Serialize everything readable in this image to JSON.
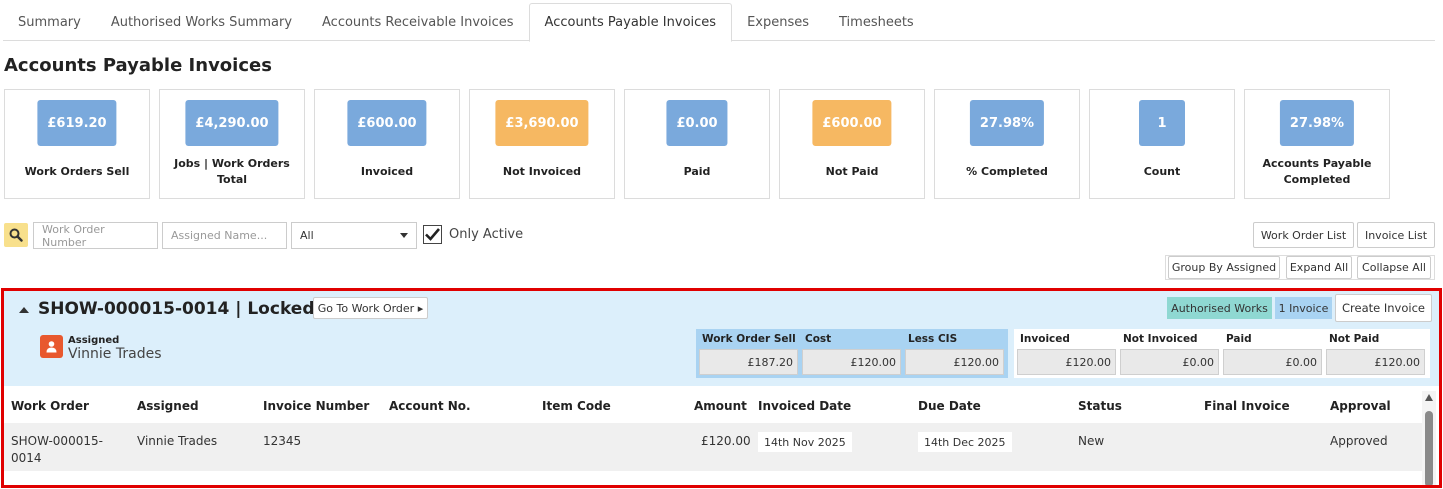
{
  "tabs": [
    {
      "label": "Summary"
    },
    {
      "label": "Authorised Works Summary"
    },
    {
      "label": "Accounts Receivable Invoices"
    },
    {
      "label": "Accounts Payable Invoices",
      "active": true
    },
    {
      "label": "Expenses"
    },
    {
      "label": "Timesheets"
    }
  ],
  "page_title": "Accounts Payable Invoices",
  "cards": [
    {
      "value": "£619.20",
      "label": "Work Orders Sell",
      "color": "#7aa9dc"
    },
    {
      "value": "£4,290.00",
      "label": "Jobs | Work Orders Total",
      "color": "#7aa9dc"
    },
    {
      "value": "£600.00",
      "label": "Invoiced",
      "color": "#7aa9dc"
    },
    {
      "value": "£3,690.00",
      "label": "Not Invoiced",
      "color": "#f6b862"
    },
    {
      "value": "£0.00",
      "label": "Paid",
      "color": "#7aa9dc"
    },
    {
      "value": "£600.00",
      "label": "Not Paid",
      "color": "#f6b862"
    },
    {
      "value": "27.98%",
      "label": "% Completed",
      "color": "#7aa9dc"
    },
    {
      "value": "1",
      "label": "Count",
      "color": "#7aa9dc"
    },
    {
      "value": "27.98%",
      "label": "Accounts Payable Completed",
      "color": "#7aa9dc"
    }
  ],
  "filters": {
    "search_icon": "search-icon",
    "work_order_placeholder": "Work Order Number",
    "assigned_placeholder": "Assigned Name...",
    "status_selected": "All",
    "only_active_label": "Only Active",
    "only_active_checked": true
  },
  "toolbar": {
    "work_order_list": "Work Order List",
    "invoice_list": "Invoice List",
    "group_by_assigned": "Group By Assigned",
    "expand_all": "Expand All",
    "collapse_all": "Collapse All"
  },
  "work_order": {
    "title": "SHOW-000015-0014 | Locked",
    "go_to_button": "Go To Work Order ▸",
    "authorised_works_badge": "Authorised Works",
    "invoice_count_badge": "1 Invoice",
    "create_invoice_button": "Create Invoice",
    "assigned_label": "Assigned",
    "assigned_name": "Vinnie Trades",
    "financials_primary": [
      {
        "label": "Work Order Sell",
        "value": "£187.20"
      },
      {
        "label": "Cost",
        "value": "£120.00"
      },
      {
        "label": "Less CIS",
        "value": "£120.00"
      }
    ],
    "financials_secondary": [
      {
        "label": "Invoiced",
        "value": "£120.00"
      },
      {
        "label": "Not Invoiced",
        "value": "£0.00"
      },
      {
        "label": "Paid",
        "value": "£0.00"
      },
      {
        "label": "Not Paid",
        "value": "£120.00"
      }
    ]
  },
  "invoice_table": {
    "columns": [
      "Work Order",
      "Assigned",
      "Invoice Number",
      "Account No.",
      "Item Code",
      "Amount",
      "Invoiced Date",
      "Due Date",
      "Status",
      "Final Invoice",
      "Approval"
    ],
    "rows": [
      {
        "work_order": "SHOW-000015-0014",
        "assigned": "Vinnie Trades",
        "invoice_number": "12345",
        "account_no": "",
        "item_code": "",
        "amount": "£120.00",
        "invoiced_date": "14th Nov 2025",
        "due_date": "14th Dec 2025",
        "status": "New",
        "final_invoice": "",
        "approval": "Approved"
      }
    ]
  },
  "colors": {
    "card_blue": "#7aa9dc",
    "card_orange": "#f6b862",
    "panel_highlight": "#e00000",
    "panel_header_bg": "#dceffb",
    "badge_teal": "#8fd8d2",
    "badge_blue": "#a9d3f2",
    "assigned_icon": "#e8582e"
  }
}
